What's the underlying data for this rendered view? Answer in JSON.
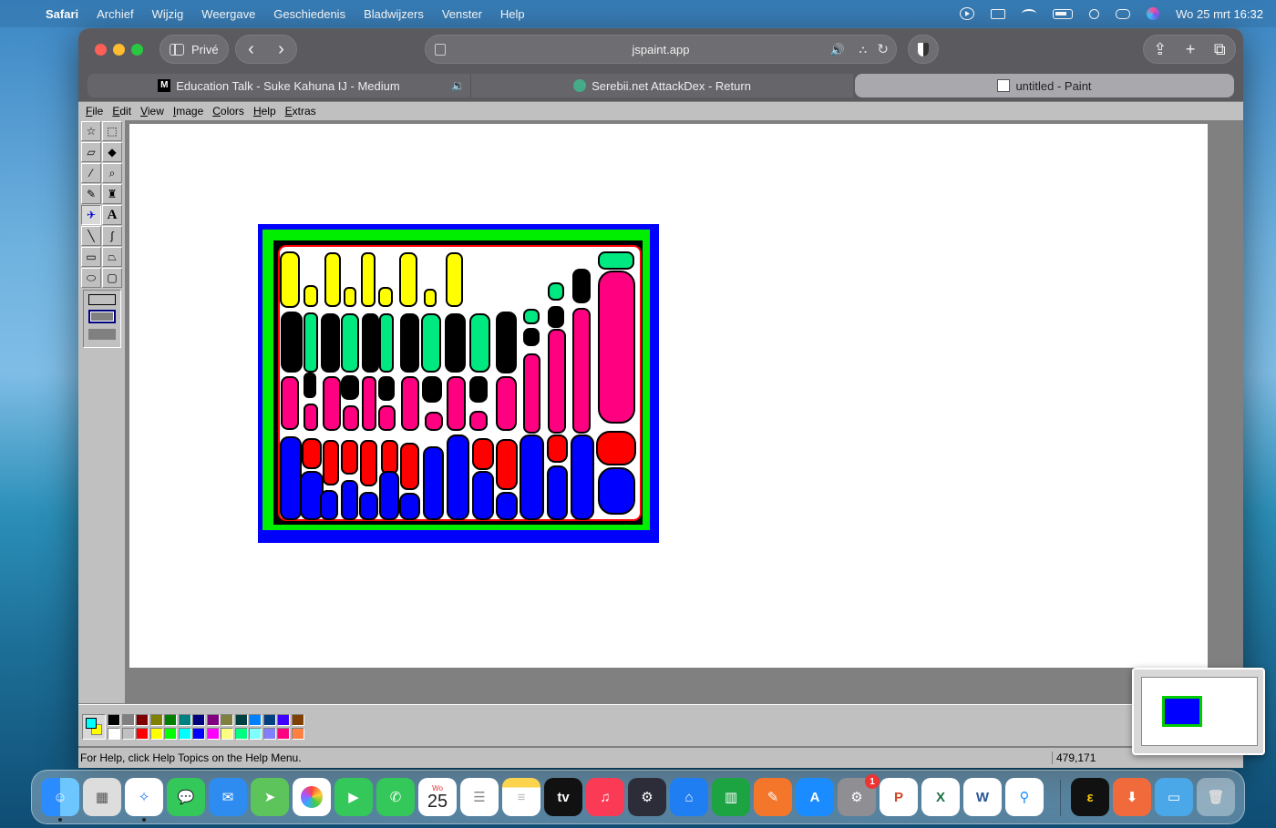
{
  "menubar": {
    "app_name": "Safari",
    "items": [
      "Archief",
      "Wijzig",
      "Weergave",
      "Geschiedenis",
      "Bladwijzers",
      "Venster",
      "Help"
    ],
    "datetime": "Wo 25 mrt  16:32"
  },
  "browser": {
    "private_label": "Privé",
    "url": "jspaint.app",
    "tabs": [
      {
        "title": "Education Talk - Suke Kahuna IJ - Medium",
        "favicon": "medium-icon"
      },
      {
        "title": "Serebii.net AttackDex - Return",
        "favicon": "serebii-icon"
      },
      {
        "title": "untitled - Paint",
        "favicon": "paint-icon",
        "active": true
      }
    ]
  },
  "paint": {
    "menu": [
      "File",
      "Edit",
      "View",
      "Image",
      "Colors",
      "Help",
      "Extras"
    ],
    "status_text": "For Help, click Help Topics on the Help Menu.",
    "coords": "479,171",
    "fg_color": "#00ffff",
    "bg_color": "#ffff00",
    "palette_top": [
      "#000000",
      "#808080",
      "#800000",
      "#808000",
      "#008000",
      "#008080",
      "#000080",
      "#800080",
      "#808040",
      "#004040",
      "#0080ff",
      "#004080",
      "#4000ff",
      "#804000"
    ],
    "palette_bottom": [
      "#ffffff",
      "#c0c0c0",
      "#ff0000",
      "#ffff00",
      "#00ff00",
      "#00ffff",
      "#0000ff",
      "#ff00ff",
      "#ffff80",
      "#00ff80",
      "#80ffff",
      "#8080ff",
      "#ff0080",
      "#ff8040"
    ],
    "drawing_colors": {
      "outer": "#0000ff",
      "green": "#00ee00",
      "black": "#000000",
      "yellow": "#ffff00",
      "mint": "#00e880",
      "pink": "#ff0080",
      "red": "#ff0000",
      "blue": "#0000ff"
    }
  },
  "dock": {
    "calendar_day": "Wo",
    "calendar_date": "25",
    "settings_badge": "1",
    "tv_label": "tv"
  }
}
